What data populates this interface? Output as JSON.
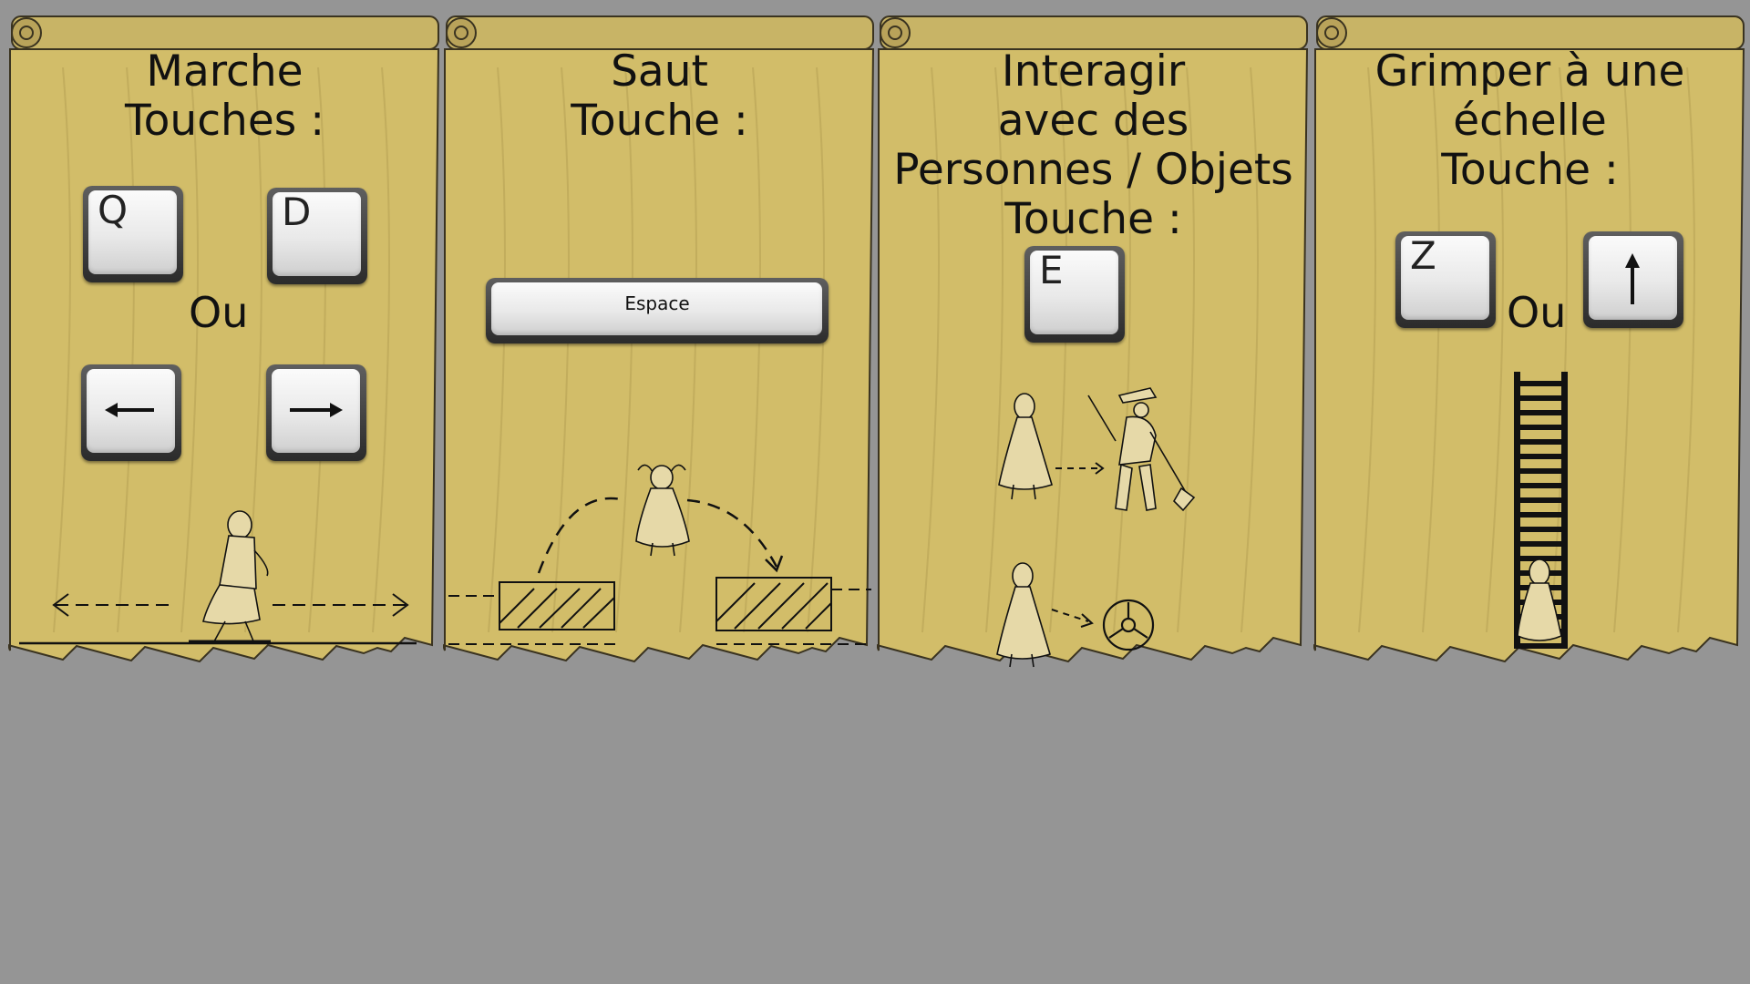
{
  "panels": [
    {
      "title_lines": [
        "Marche",
        "Touches :"
      ],
      "keys": [
        "Q",
        "D"
      ],
      "arrow_keys": [
        "left-arrow",
        "right-arrow"
      ],
      "or_label": "Ou",
      "illustration": "walking-girl-arrows"
    },
    {
      "title_lines": [
        "Saut",
        "Touche :"
      ],
      "key_label": "Espace",
      "illustration": "jumping-girl-between-platforms"
    },
    {
      "title_lines": [
        "Interagir",
        "avec des",
        "Personnes / Objets",
        "Touche :"
      ],
      "key_label": "E",
      "illustration": "girl-interacting-with-farmer-and-wheel"
    },
    {
      "title_lines": [
        "Grimper à une",
        "échelle",
        "Touche :"
      ],
      "key_label": "Z",
      "arrow_key": "up-arrow",
      "or_label": "Ou",
      "illustration": "girl-climbing-ladder"
    }
  ],
  "colors": {
    "background": "#959595",
    "parchment": "#d2bd69",
    "roll": "#c8b466"
  }
}
